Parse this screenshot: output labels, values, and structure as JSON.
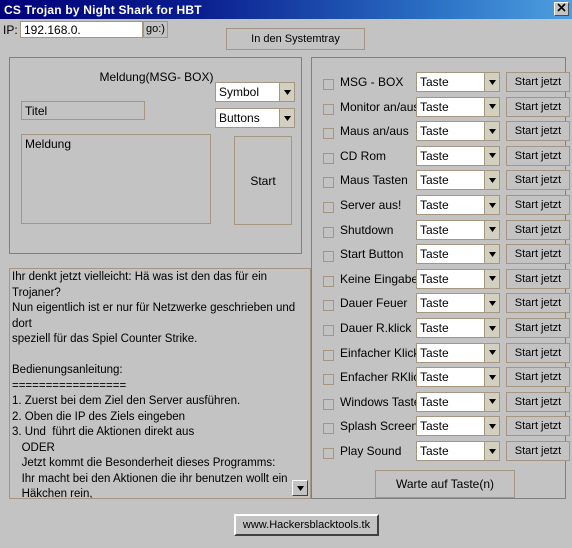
{
  "window": {
    "title": "CS Trojan by Night Shark for HBT",
    "close_label": "×",
    "titlebar_color": "#00007a",
    "face_color": "#c3c3c3",
    "border_color": "#a59682"
  },
  "toolbar": {
    "ip_label": "IP:",
    "ip_value": "192.168.0.",
    "ip_placeholder": "",
    "go_label": "go:)",
    "systray_label": "In den Systemtray"
  },
  "msgbox": {
    "title": "Meldung(MSG- BOX)",
    "titel_value": "Titel",
    "titel_placeholder": "Titel",
    "meldung_value": "Meldung",
    "meldung_placeholder": "Meldung",
    "symbol_label": "Symbol",
    "buttons_label": "Buttons",
    "start_label": "Start"
  },
  "info": {
    "text": "Ihr denkt jetzt vielleicht: Hä was ist den das für ein\nTrojaner?\nNun eigentlich ist er nur für Netzwerke geschrieben und\ndort\nspeziell für das Spiel Counter Strike.\n\nBedienungsanleitung:\n=================\n1. Zuerst bei dem Ziel den Server ausführen.\n2. Oben die IP des Ziels eingeben\n3. Und  führt die Aktionen direkt aus\n   ODER\n   Jetzt kommt die Besonderheit dieses Programms:\n   Ihr macht bei den Aktionen die ihr benutzen wollt ein\n   Häkchen rein,\n   dann gebt ihr hinten eine Taste ein. Als letztes drückt\n   ihr noch auf 'Warte"
  },
  "actions": {
    "taste_label": "Taste",
    "start_label": "Start jetzt",
    "warte_label": "Warte auf Taste(n)",
    "rows": [
      {
        "label": "MSG - BOX",
        "taste": "Taste",
        "start": "Start jetzt",
        "checked": false
      },
      {
        "label": "Monitor an/aus",
        "taste": "Taste",
        "start": "Start jetzt",
        "checked": false
      },
      {
        "label": "Maus an/aus",
        "taste": "Taste",
        "start": "Start jetzt",
        "checked": false
      },
      {
        "label": "CD Rom",
        "taste": "Taste",
        "start": "Start jetzt",
        "checked": false
      },
      {
        "label": "Maus Tasten",
        "taste": "Taste",
        "start": "Start jetzt",
        "checked": false
      },
      {
        "label": "Server aus!",
        "taste": "Taste",
        "start": "Start jetzt",
        "checked": false
      },
      {
        "label": "Shutdown",
        "taste": "Taste",
        "start": "Start jetzt",
        "checked": false
      },
      {
        "label": "Start Button",
        "taste": "Taste",
        "start": "Start jetzt",
        "checked": false
      },
      {
        "label": "Keine Eingaben",
        "taste": "Taste",
        "start": "Start jetzt",
        "checked": false
      },
      {
        "label": "Dauer Feuer",
        "taste": "Taste",
        "start": "Start jetzt",
        "checked": false
      },
      {
        "label": "Dauer R.klick",
        "taste": "Taste",
        "start": "Start jetzt",
        "checked": false
      },
      {
        "label": "Einfacher Klick",
        "taste": "Taste",
        "start": "Start jetzt",
        "checked": false
      },
      {
        "label": "Enfacher RKlick",
        "taste": "Taste",
        "start": "Start jetzt",
        "checked": false
      },
      {
        "label": "Windows Taste",
        "taste": "Taste",
        "start": "Start jetzt",
        "checked": false
      },
      {
        "label": "Splash Screen",
        "taste": "Taste",
        "start": "Start jetzt",
        "checked": false
      },
      {
        "label": "Play Sound",
        "taste": "Taste",
        "start": "Start jetzt",
        "checked": false
      }
    ]
  },
  "footer": {
    "website_label": "www.Hackersblacktools.tk"
  }
}
